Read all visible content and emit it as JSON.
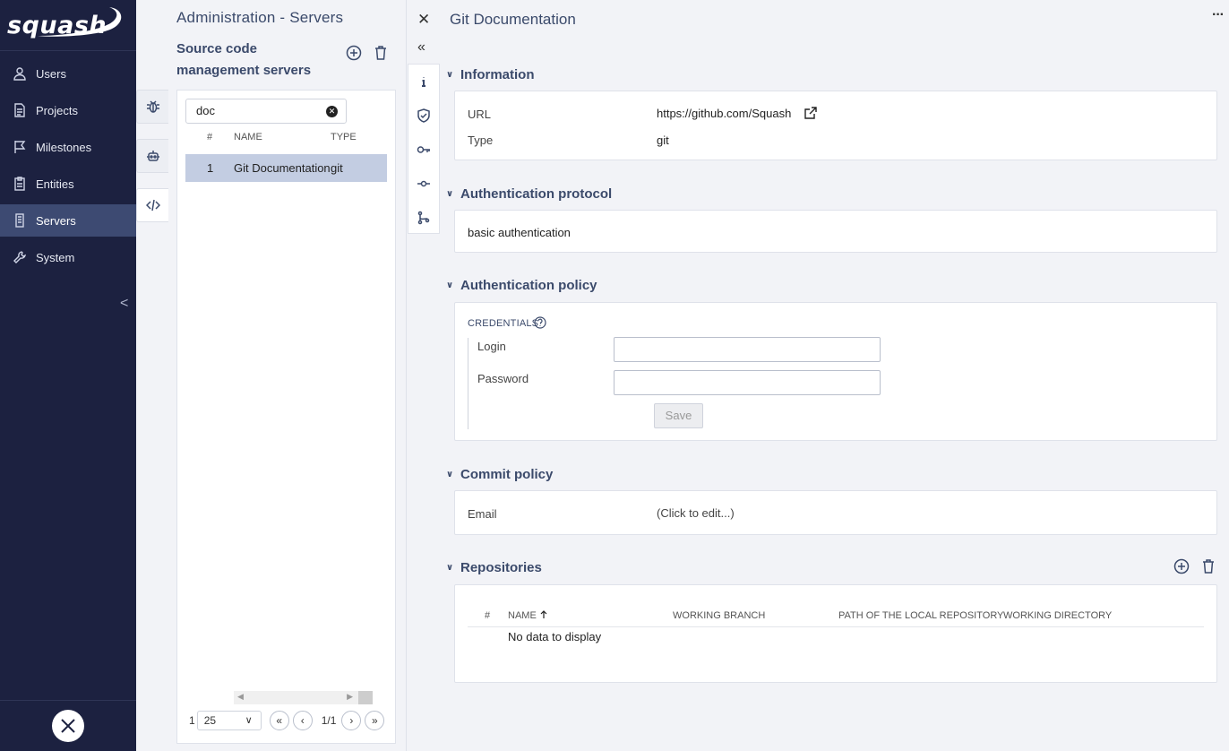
{
  "app": {
    "logo_text": "squash"
  },
  "nav": {
    "items": [
      {
        "label": "Users",
        "icon": "user-icon"
      },
      {
        "label": "Projects",
        "icon": "document-icon"
      },
      {
        "label": "Milestones",
        "icon": "flag-icon"
      },
      {
        "label": "Entities",
        "icon": "clipboard-icon"
      },
      {
        "label": "Servers",
        "icon": "server-icon",
        "active": true
      },
      {
        "label": "System",
        "icon": "wrench-icon"
      }
    ],
    "collapse": "<"
  },
  "middle": {
    "page_title": "Administration - Servers",
    "sub_title": "Source code management servers",
    "search_value": "doc",
    "columns": {
      "index": "#",
      "name": "NAME",
      "type": "TYPE"
    },
    "rows": [
      {
        "index": "1",
        "name": "Git Documentation",
        "type": "git"
      }
    ],
    "pager": {
      "prefix": "1",
      "page_size": "25",
      "page_text": "1/1"
    }
  },
  "detail": {
    "title": "Git Documentation",
    "sections": {
      "information": {
        "title": "Information",
        "url_label": "URL",
        "url_value": "https://github.com/Squash",
        "type_label": "Type",
        "type_value": "git"
      },
      "auth_protocol": {
        "title": "Authentication protocol",
        "value": "basic authentication"
      },
      "auth_policy": {
        "title": "Authentication policy",
        "credentials_label": "CREDENTIALS",
        "login_label": "Login",
        "login_value": "",
        "password_label": "Password",
        "password_value": "",
        "save_label": "Save"
      },
      "commit_policy": {
        "title": "Commit policy",
        "email_label": "Email",
        "email_value": "(Click to edit...)"
      },
      "repositories": {
        "title": "Repositories",
        "columns": {
          "index": "#",
          "name": "NAME",
          "branch": "WORKING BRANCH",
          "path": "PATH OF THE LOCAL REPOSITORY",
          "dir": "WORKING DIRECTORY"
        },
        "empty": "No data to display"
      }
    }
  }
}
